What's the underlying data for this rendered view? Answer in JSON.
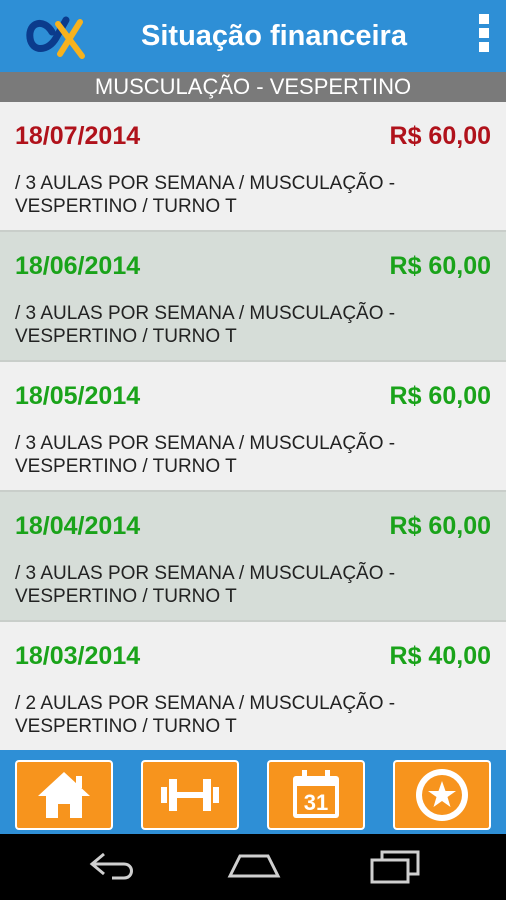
{
  "app": {
    "title": "Situação financeira",
    "logo_icon": "alpha-x-logo-icon",
    "menu_icon": "overflow-menu-icon",
    "brand_color": "#2e8fd6",
    "accent_color": "#f7941d"
  },
  "section": {
    "header": "MUSCULAÇÃO - VESPERTINO"
  },
  "payments": [
    {
      "date": "18/07/2014",
      "amount": "R$ 60,00",
      "description": " / 3 AULAS POR SEMANA / MUSCULAÇÃO - VESPERTINO / TURNO T",
      "status_color": "#b0121b"
    },
    {
      "date": "18/06/2014",
      "amount": "R$ 60,00",
      "description": " / 3 AULAS POR SEMANA / MUSCULAÇÃO - VESPERTINO / TURNO T",
      "status_color": "#1aa31a"
    },
    {
      "date": "18/05/2014",
      "amount": "R$ 60,00",
      "description": " / 3 AULAS POR SEMANA / MUSCULAÇÃO - VESPERTINO / TURNO T",
      "status_color": "#1aa31a"
    },
    {
      "date": "18/04/2014",
      "amount": "R$ 60,00",
      "description": " / 3 AULAS POR SEMANA / MUSCULAÇÃO - VESPERTINO / TURNO T",
      "status_color": "#1aa31a"
    },
    {
      "date": "18/03/2014",
      "amount": "R$ 40,00",
      "description": " / 2 AULAS POR SEMANA / MUSCULAÇÃO - VESPERTINO / TURNO T",
      "status_color": "#1aa31a"
    }
  ],
  "bottom_nav": [
    {
      "icon": "home-icon"
    },
    {
      "icon": "dumbbell-icon"
    },
    {
      "icon": "calendar-icon",
      "day": "31"
    },
    {
      "icon": "star-badge-icon"
    }
  ],
  "system_nav": [
    {
      "icon": "back-icon"
    },
    {
      "icon": "home-outline-icon"
    },
    {
      "icon": "recent-apps-icon"
    }
  ]
}
